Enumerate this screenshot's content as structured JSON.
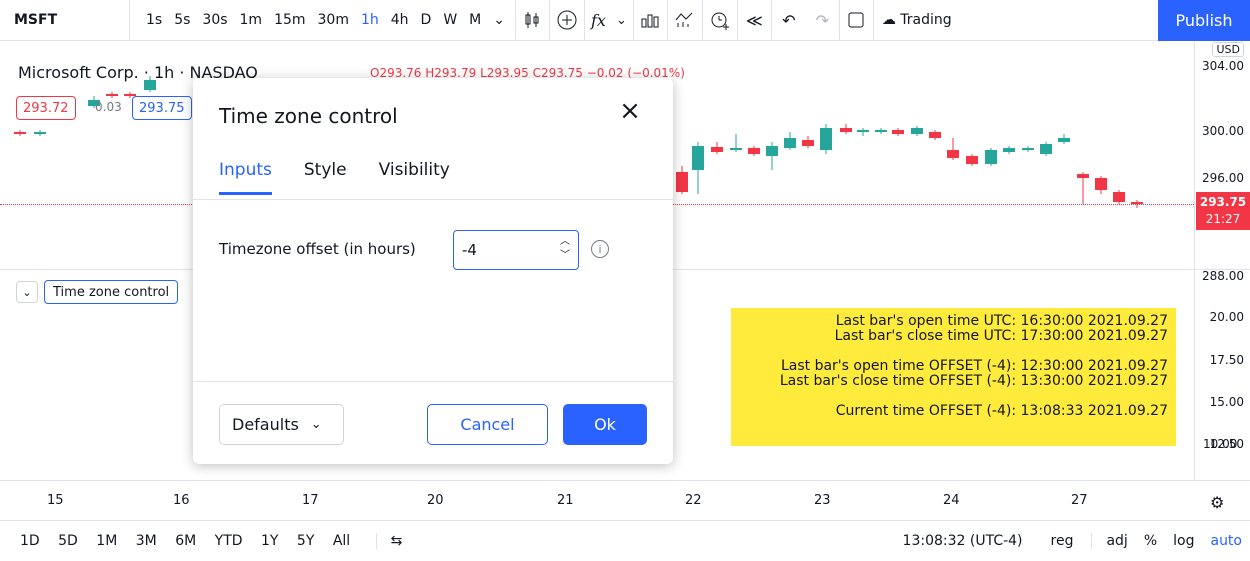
{
  "toolbar": {
    "symbol": "MSFT",
    "intervals": [
      "1s",
      "5s",
      "30s",
      "1m",
      "15m",
      "30m",
      "1h",
      "4h",
      "D",
      "W",
      "M"
    ],
    "active_interval": "1h",
    "trading_label": "Trading",
    "publish_label": "Publish"
  },
  "legend": {
    "title": "Microsoft Corp. · 1h · NASDAQ",
    "ohlc": "O293.76 H293.79 L293.95 C293.75 −0.02 (−0.01%)",
    "bid": "293.72",
    "spread": "0.03",
    "ask": "293.75"
  },
  "price_scale": {
    "currency": "USD",
    "main_ticks": [
      "304.00",
      "300.00",
      "296.00",
      "288.00"
    ],
    "current_price": "293.75",
    "countdown": "21:27",
    "indicator_ticks": [
      "20.00",
      "17.50",
      "15.00",
      "12.50",
      "10.00"
    ]
  },
  "indicator": {
    "name": "Time zone control",
    "lines": [
      "Last bar's open time UTC: 16:30:00 2021.09.27",
      "Last bar's close time UTC: 17:30:00 2021.09.27",
      "",
      "Last bar's open time OFFSET (-4): 12:30:00 2021.09.27",
      "Last bar's close time OFFSET (-4): 13:30:00 2021.09.27",
      "",
      "Current time OFFSET (-4): 13:08:33 2021.09.27"
    ]
  },
  "time_axis": [
    "15",
    "16",
    "17",
    "20",
    "21",
    "22",
    "23",
    "24",
    "27"
  ],
  "bottombar": {
    "ranges": [
      "1D",
      "5D",
      "1M",
      "3M",
      "6M",
      "YTD",
      "1Y",
      "5Y",
      "All"
    ],
    "clock": "13:08:32 (UTC-4)",
    "reg": "reg",
    "adj": "adj",
    "percent": "%",
    "log": "log",
    "auto": "auto"
  },
  "dialog": {
    "title": "Time zone control",
    "tabs": [
      "Inputs",
      "Style",
      "Visibility"
    ],
    "field_label": "Timezone offset (in hours)",
    "field_value": "-4",
    "defaults_label": "Defaults",
    "cancel_label": "Cancel",
    "ok_label": "Ok"
  },
  "colors": {
    "accent": "#2962ff",
    "down": "#f23645",
    "up": "#26a69a",
    "highlight": "#ffeb3b"
  }
}
